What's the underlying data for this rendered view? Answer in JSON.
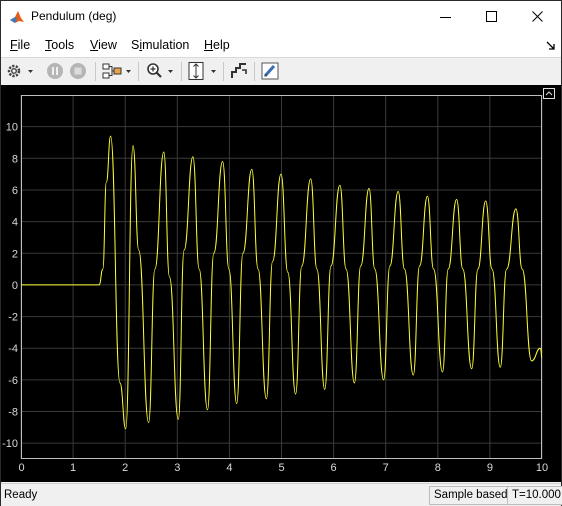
{
  "window": {
    "title": "Pendulum (deg)",
    "app_icon": "matlab-icon",
    "controls": [
      "minimize-icon",
      "maximize-icon",
      "close-icon"
    ]
  },
  "menubar": {
    "items": [
      {
        "label": "File",
        "mnemonic": "F",
        "rest": "ile"
      },
      {
        "label": "Tools",
        "mnemonic": "T",
        "rest": "ools"
      },
      {
        "label": "View",
        "mnemonic": "V",
        "rest": "iew"
      },
      {
        "label": "Simulation",
        "pre": "S",
        "mnemonic": "i",
        "rest": "mulation"
      },
      {
        "label": "Help",
        "mnemonic": "H",
        "rest": "elp"
      }
    ]
  },
  "toolbar": {
    "buttons": [
      "settings-icon",
      "run-icon",
      "stop-icon",
      "signal-selector-icon",
      "zoom-icon",
      "scale-axes-icon",
      "highlight-block-icon",
      "style-icon"
    ]
  },
  "colors": {
    "trace": "#ffff33",
    "axes_bg": "#000000",
    "grid": "#3a3a3a",
    "axis_text": "#dadada",
    "frame": "#bfbfbf"
  },
  "chart_data": {
    "type": "line",
    "title": "",
    "xlabel": "",
    "ylabel": "",
    "xlim": [
      0,
      10
    ],
    "ylim": [
      -11,
      12
    ],
    "xticks": [
      0,
      1,
      2,
      3,
      4,
      5,
      6,
      7,
      8,
      9,
      10
    ],
    "yticks": [
      -10,
      -8,
      -6,
      -4,
      -2,
      0,
      2,
      4,
      6,
      8,
      10
    ],
    "grid": true,
    "series": [
      {
        "color": "#ffff33",
        "step_time": 1.5,
        "initial_value": 0,
        "x": [
          0,
          1.5,
          1.57,
          1.64,
          1.72,
          1.9,
          2.01,
          2.15,
          2.26,
          2.45,
          2.57,
          2.74,
          2.85,
          3.02,
          3.13,
          3.3,
          3.42,
          3.58,
          3.7,
          3.87,
          3.99,
          4.14,
          4.26,
          4.43,
          4.55,
          4.71,
          4.83,
          4.99,
          5.12,
          5.27,
          5.39,
          5.56,
          5.68,
          5.83,
          5.95,
          6.12,
          6.24,
          6.4,
          6.52,
          6.68,
          6.79,
          6.96,
          7.08,
          7.24,
          7.36,
          7.53,
          7.65,
          7.8,
          7.92,
          8.09,
          8.2,
          8.36,
          8.48,
          8.65,
          8.77,
          8.92,
          9.04,
          9.2,
          9.32,
          9.5,
          9.62,
          9.8,
          9.97,
          10.0
        ],
        "y": [
          0,
          0,
          1.0,
          6.5,
          9.4,
          -6.2,
          -9.1,
          8.8,
          2.2,
          -8.7,
          1.0,
          8.4,
          0.5,
          -8.5,
          2.2,
          8.1,
          1.0,
          -7.9,
          2.0,
          7.8,
          1.0,
          -7.5,
          2.0,
          7.3,
          1.0,
          -7.2,
          1.5,
          7.0,
          0.8,
          -6.9,
          1.2,
          6.7,
          1.0,
          -6.6,
          1.2,
          6.3,
          1.0,
          -6.2,
          1.2,
          6.1,
          1.0,
          -6.0,
          1.2,
          5.9,
          1.0,
          -5.7,
          1.2,
          5.6,
          1.0,
          -5.5,
          1.0,
          5.4,
          1.0,
          -5.3,
          1.0,
          5.3,
          1.0,
          -5.2,
          1.0,
          4.8,
          1.0,
          -4.8,
          -4.0,
          -4.6
        ]
      }
    ]
  },
  "status": {
    "state": "Ready",
    "mode": "Sample based",
    "time": "T=10.000"
  }
}
